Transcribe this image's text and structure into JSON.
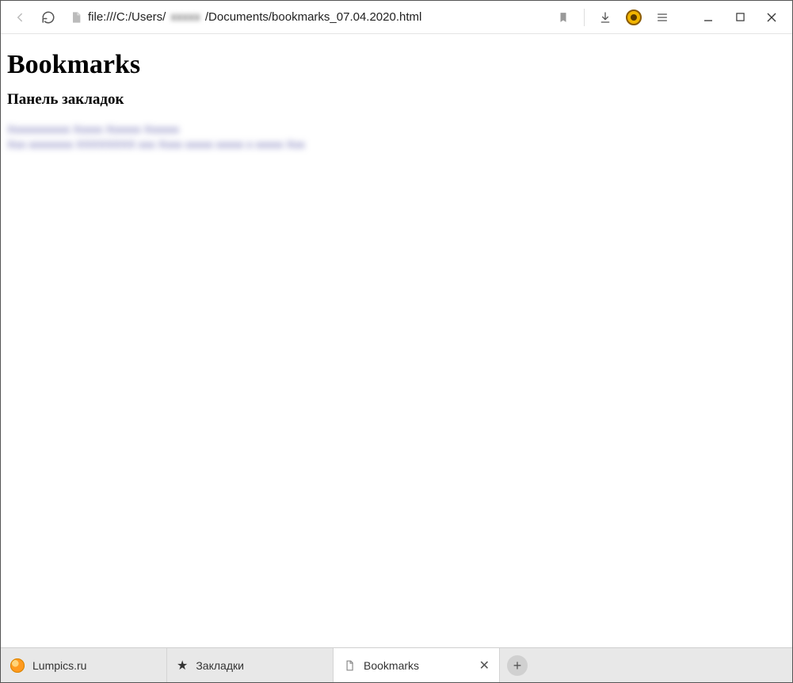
{
  "toolbar": {
    "url_prefix": "file:///C:/Users/",
    "url_blurred_segment": "xxxxx",
    "url_suffix": "/Documents/bookmarks_07.04.2020.html"
  },
  "page": {
    "heading": "Bookmarks",
    "subheading": "Панель закладок"
  },
  "tabs": [
    {
      "label": "Lumpics.ru"
    },
    {
      "label": "Закладки"
    },
    {
      "label": "Bookmarks"
    }
  ]
}
